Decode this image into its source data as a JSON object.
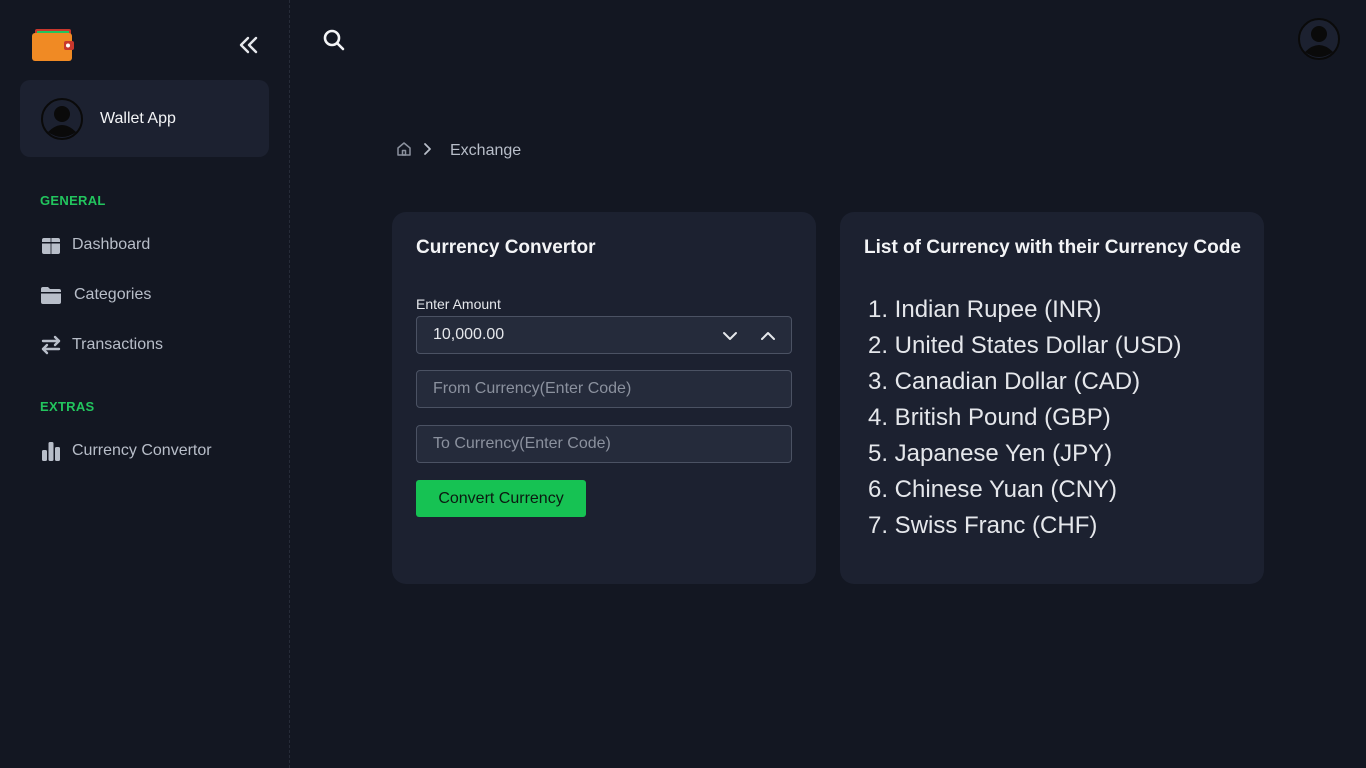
{
  "app": {
    "name": "Wallet App"
  },
  "sidebar": {
    "sections": [
      {
        "title": "GENERAL",
        "items": [
          {
            "label": "Dashboard",
            "icon": "dashboard-icon"
          },
          {
            "label": "Categories",
            "icon": "folder-icon"
          },
          {
            "label": "Transactions",
            "icon": "arrows-swap-icon"
          }
        ]
      },
      {
        "title": "EXTRAS",
        "items": [
          {
            "label": "Currency Convertor",
            "icon": "bar-chart-icon"
          }
        ]
      }
    ]
  },
  "breadcrumb": {
    "current": "Exchange"
  },
  "converter": {
    "title": "Currency Convertor",
    "amount_label": "Enter Amount",
    "amount_value": "10,000.00",
    "from_placeholder": "From Currency(Enter Code)",
    "to_placeholder": "To Currency(Enter Code)",
    "button_label": "Convert Currency"
  },
  "currency_list": {
    "title": "List of Currency with their Currency Code",
    "items": [
      "1. Indian Rupee (INR)",
      "2. United States Dollar (USD)",
      "3. Canadian Dollar (CAD)",
      "4. British Pound (GBP)",
      "5. Japanese Yen (JPY)",
      "6. Chinese Yuan (CNY)",
      "7. Swiss Franc (CHF)"
    ]
  },
  "colors": {
    "background": "#131722",
    "card": "#1c2130",
    "accent": "#16c253",
    "section": "#22c55e"
  }
}
